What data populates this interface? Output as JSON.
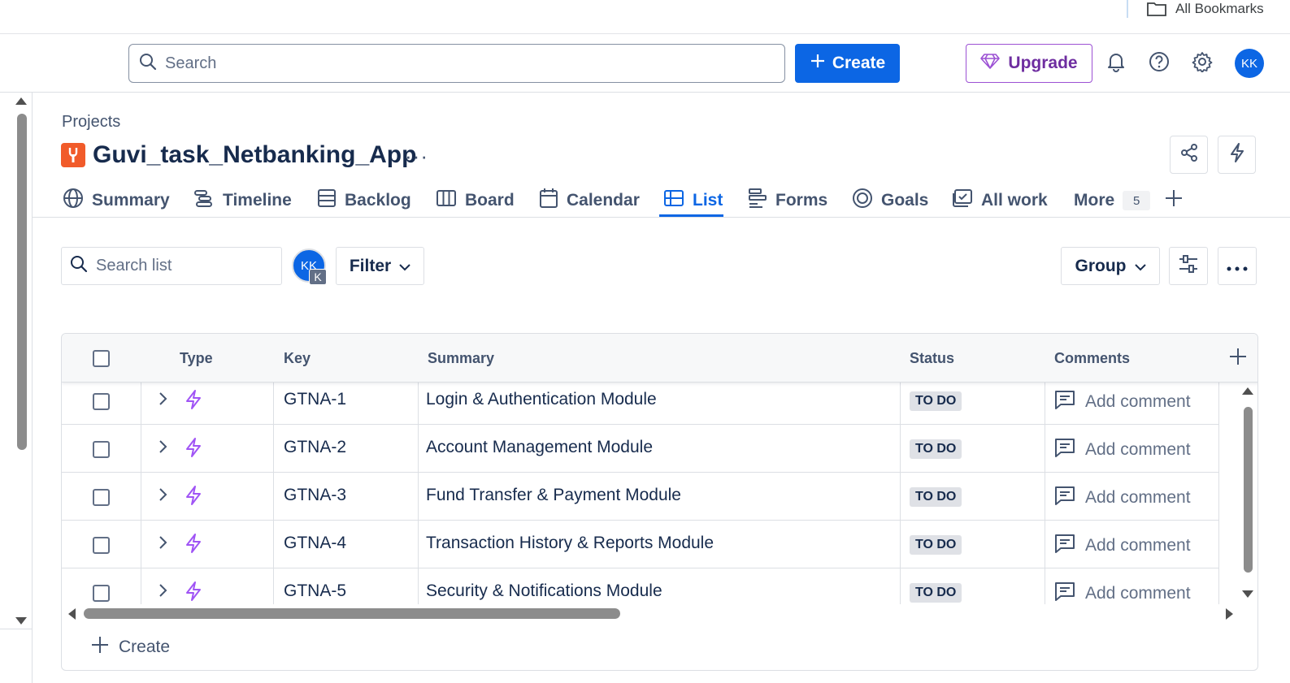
{
  "bookmarks": {
    "all_bookmarks_label": "All Bookmarks"
  },
  "topnav": {
    "search_placeholder": "Search",
    "create_label": "Create",
    "upgrade_label": "Upgrade",
    "avatar_initials": "KK",
    "icons": [
      "bell-icon",
      "help-icon",
      "settings-icon"
    ]
  },
  "header": {
    "breadcrumb": "Projects",
    "project_name": "Guvi_task_Netbanking_App",
    "more_glyph": "···"
  },
  "tabs": [
    {
      "label": "Summary",
      "icon": "globe-icon"
    },
    {
      "label": "Timeline",
      "icon": "timeline-icon"
    },
    {
      "label": "Backlog",
      "icon": "backlog-icon"
    },
    {
      "label": "Board",
      "icon": "board-icon"
    },
    {
      "label": "Calendar",
      "icon": "calendar-icon"
    },
    {
      "label": "List",
      "icon": "list-icon",
      "active": true
    },
    {
      "label": "Forms",
      "icon": "forms-icon"
    },
    {
      "label": "Goals",
      "icon": "goals-icon"
    },
    {
      "label": "All work",
      "icon": "all-work-icon"
    },
    {
      "label": "More",
      "count": "5"
    }
  ],
  "toolbar": {
    "search_placeholder": "Search list",
    "avatar_initials": "KK",
    "avatar_badge": "K",
    "filter_label": "Filter",
    "group_label": "Group"
  },
  "table": {
    "columns": [
      "Type",
      "Key",
      "Summary",
      "Status",
      "Comments"
    ],
    "rows": [
      {
        "key": "GTNA-1",
        "summary": "Login & Authentication Module",
        "status": "TO DO",
        "comment": "Add comment"
      },
      {
        "key": "GTNA-2",
        "summary": "Account Management Module",
        "status": "TO DO",
        "comment": "Add comment"
      },
      {
        "key": "GTNA-3",
        "summary": "Fund Transfer & Payment Module",
        "status": "TO DO",
        "comment": "Add comment"
      },
      {
        "key": "GTNA-4",
        "summary": "Transaction History & Reports Module",
        "status": "TO DO",
        "comment": "Add comment"
      },
      {
        "key": "GTNA-5",
        "summary": "Security & Notifications Module",
        "status": "TO DO",
        "comment": "Add comment"
      }
    ],
    "create_label": "Create"
  },
  "colors": {
    "brand_blue": "#0c66e4",
    "upgrade_purple": "#6e2da0",
    "epic_purple": "#a054f5",
    "project_orange": "#f15b2a",
    "status_gray": "#dfe1e6"
  }
}
